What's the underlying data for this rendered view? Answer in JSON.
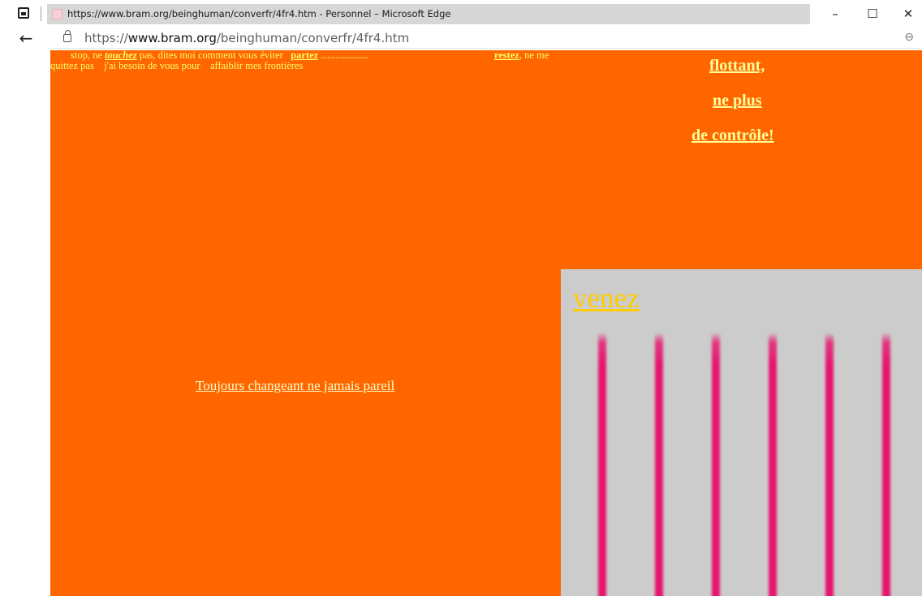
{
  "window": {
    "tab_title": "https://www.bram.org/beinghuman/converfr/4fr4.htm - Personnel – Microsoft Edge",
    "minimize_glyph": "–",
    "maximize_glyph": "☐",
    "close_glyph": "✕"
  },
  "addressbar": {
    "back_glyph": "←",
    "url_prefix": "https://",
    "url_domain": "www.bram.org",
    "url_path": "/beinghuman/converfr/4fr4.htm",
    "zoom_glyph": "⊖"
  },
  "page": {
    "colors": {
      "background": "#ff6600",
      "panel": "#cccccc",
      "text_yellow": "#ffff66",
      "stripe": "#e6146e"
    },
    "para": {
      "s1": "stop, ne ",
      "touchez": "touchez",
      "s2": " pas, dites moi comment vous éviter   ",
      "partez": "partez",
      "dots": " ......................",
      "gap": "                                                  ",
      "restez": "restez",
      "s3": ", ne me quittez pas    j'ai besoin de vous pour    affaiblir mes frontières"
    },
    "right_links": [
      "flottant,",
      "ne plus",
      "de contrôle!"
    ],
    "center_link": "Toujours changeant ne jamais pareil",
    "panel_link": "venez"
  }
}
